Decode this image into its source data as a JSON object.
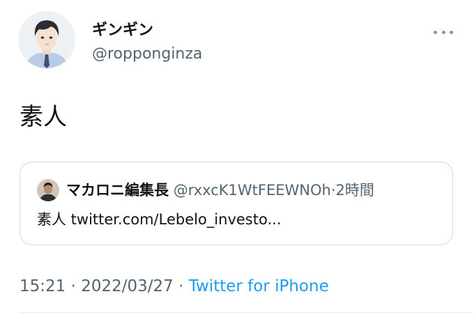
{
  "author": {
    "display_name": "ギンギン",
    "handle": "@ropponginza"
  },
  "tweet": {
    "text": "素人"
  },
  "quote": {
    "display_name": "マカロニ編集長",
    "handle": "@rxxcK1WtFEEWNOh",
    "separator": "·",
    "time_ago": "2時間",
    "text": "素人 twitter.com/Lebelo_investo..."
  },
  "meta": {
    "time": "15:21",
    "separator1": "·",
    "date": "2022/03/27",
    "separator2": "·",
    "source": "Twitter for iPhone"
  },
  "icons": {
    "more": "more-horizontal-icon",
    "link_color": "#1d9bf0"
  }
}
